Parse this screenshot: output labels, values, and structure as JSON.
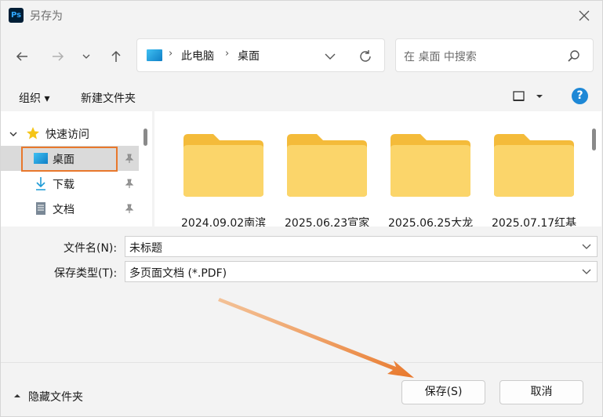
{
  "window": {
    "title": "另存为",
    "app_icon_text": "Ps"
  },
  "address_bar": {
    "segments": [
      "此电脑",
      "桌面"
    ]
  },
  "search": {
    "placeholder": "在 桌面 中搜索"
  },
  "toolbar": {
    "organize_label": "组织 ▾",
    "new_folder_label": "新建文件夹"
  },
  "nav_pane": {
    "quick_access": "快速访问",
    "items": [
      {
        "label": "桌面",
        "icon": "desktop-icon",
        "selected": true
      },
      {
        "label": "下载",
        "icon": "download-icon"
      },
      {
        "label": "文档",
        "icon": "document-icon"
      }
    ]
  },
  "files": [
    {
      "label": "2024.09.02南滨"
    },
    {
      "label": "2025.06.23宣家"
    },
    {
      "label": "2025.06.25大龙"
    },
    {
      "label": "2025.07.17红基"
    }
  ],
  "form": {
    "filename_label": "文件名(N):",
    "filename_value": "未标题",
    "filetype_label": "保存类型(T):",
    "filetype_value": "多页面文档 (*.PDF)"
  },
  "footer": {
    "hide_folders_label": "隐藏文件夹",
    "save_label": "保存(S)",
    "cancel_label": "取消"
  },
  "colors": {
    "annotation": "#e8782c",
    "folder": "#f8cf55",
    "help": "#1e88d6"
  }
}
